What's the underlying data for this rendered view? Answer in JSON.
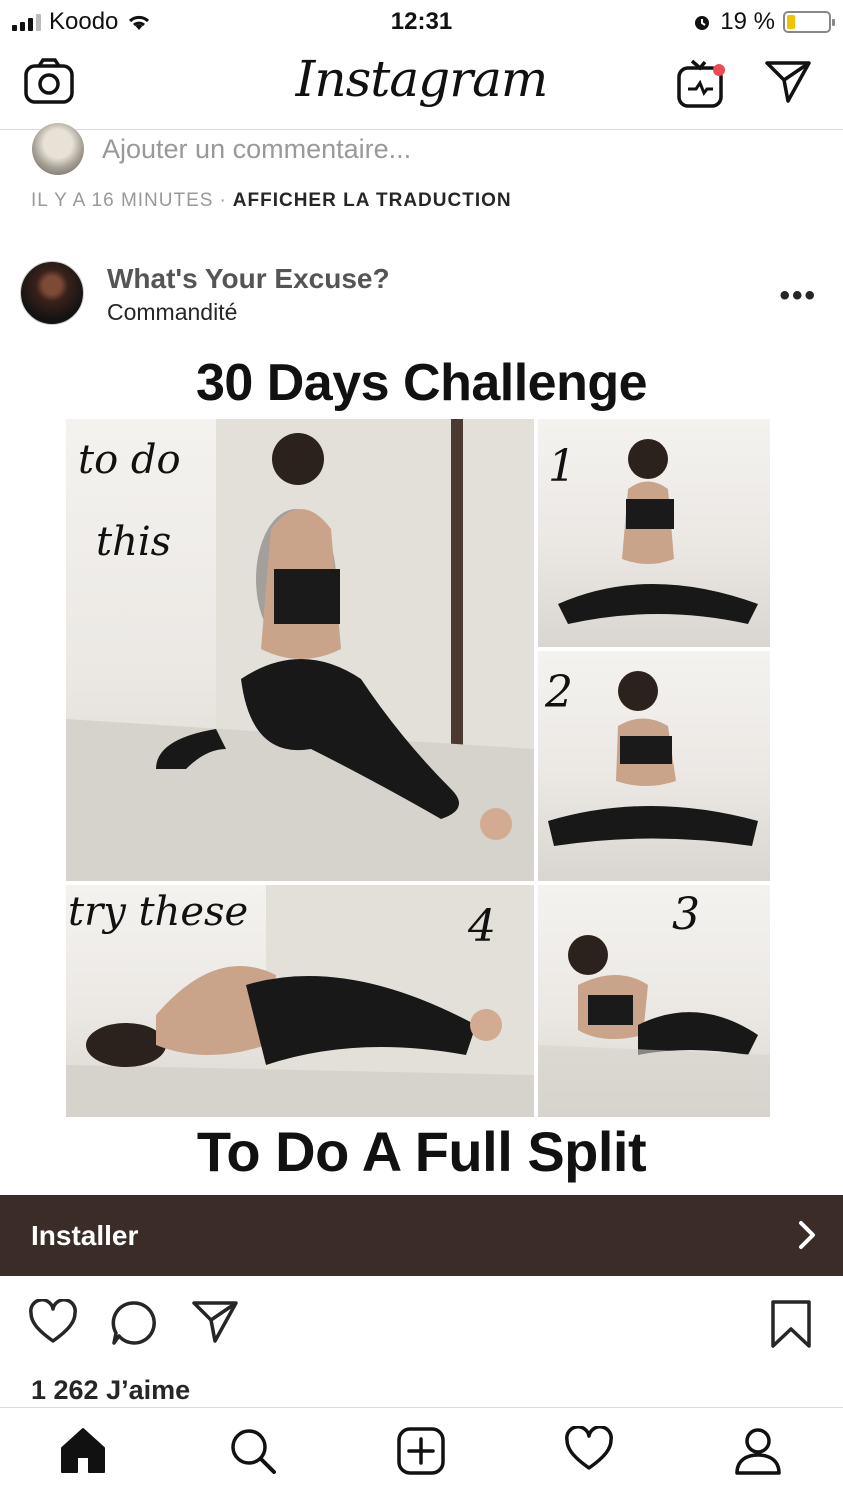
{
  "status_bar": {
    "carrier": "Koodo",
    "time": "12:31",
    "battery": "19 %",
    "battery_level": 0.19
  },
  "header": {
    "brand": "Instagram",
    "icons": [
      "camera-icon",
      "igtv-icon",
      "direct-message-icon"
    ]
  },
  "previous_post": {
    "comment_placeholder": "Ajouter un commentaire...",
    "time_ago": "IL Y A 16 MINUTES",
    "separator": "·",
    "translate_label": "AFFICHER LA TRADUCTION"
  },
  "post": {
    "username": "What's Your Excuse?",
    "sponsored_label": "Commandité",
    "image": {
      "title": "30 Days Challenge",
      "subtitle": "To Do A Full Split",
      "label_to_do": "to do",
      "label_this": "this",
      "label_try": "try these",
      "step_1": "1",
      "step_2": "2",
      "step_3": "3",
      "step_4": "4"
    },
    "cta_label": "Installer",
    "likes": "1 262 J’aime"
  },
  "tab_bar": {
    "icons": [
      "home-icon",
      "search-icon",
      "new-post-icon",
      "activity-icon",
      "profile-icon"
    ]
  },
  "colors": {
    "cta_background": "#3b2c27",
    "notification_dot": "#ed4956",
    "battery_fill": "#f2c200"
  }
}
